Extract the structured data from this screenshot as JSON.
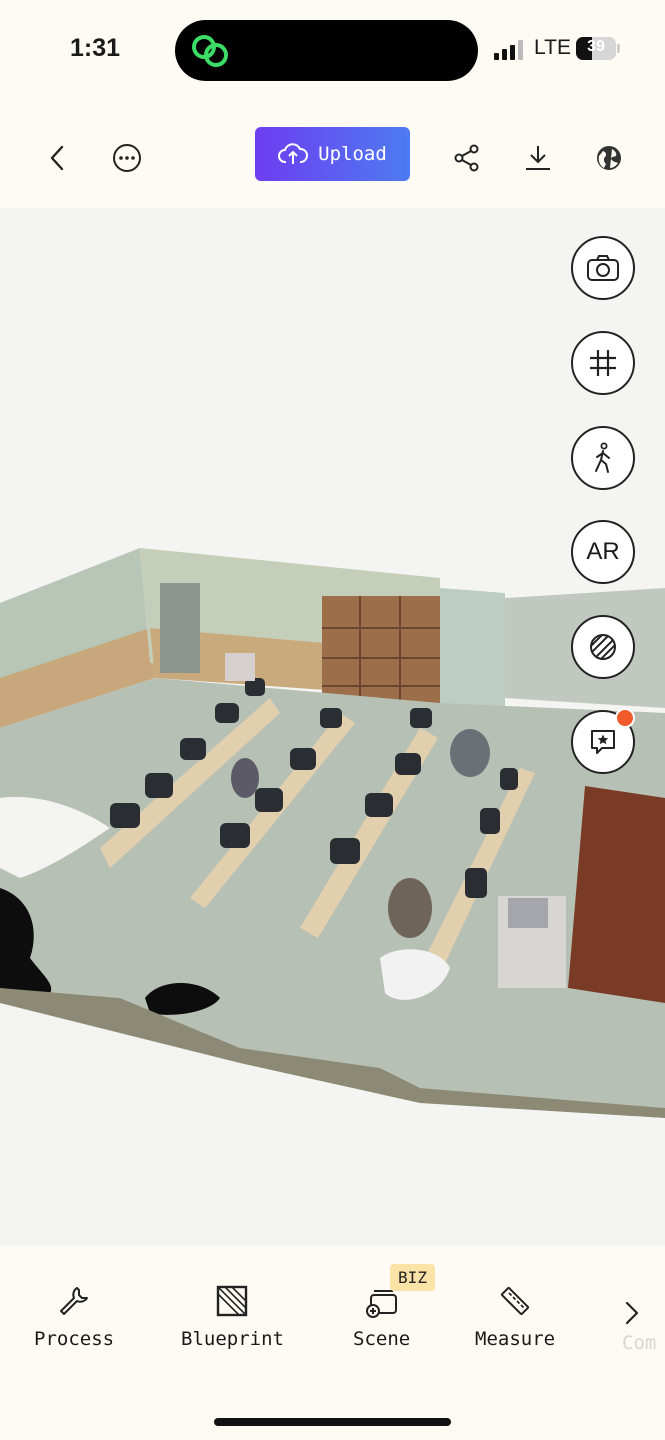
{
  "status_bar": {
    "time": "1:31",
    "network": "LTE",
    "battery": "39",
    "battery_level": 0.39
  },
  "toolbar": {
    "upload_label": "Upload",
    "accent_start": "#6d3df0",
    "accent_end": "#4d7bf3"
  },
  "side_controls": [
    "camera-icon",
    "grid-icon",
    "walk-icon",
    "AR",
    "texture-icon",
    "annotation-icon"
  ],
  "side_controls_labels": {
    "ar": "AR"
  },
  "tabs": {
    "process": "Process",
    "blueprint": "Blueprint",
    "scene": "Scene",
    "scene_badge": "BIZ",
    "measure": "Measure",
    "next_partial": "Com"
  },
  "colors": {
    "background": "#fdfbf3",
    "viewport": "#f4f4f3",
    "notification_dot": "#f25a2c",
    "badge": "#fbe2a6"
  }
}
